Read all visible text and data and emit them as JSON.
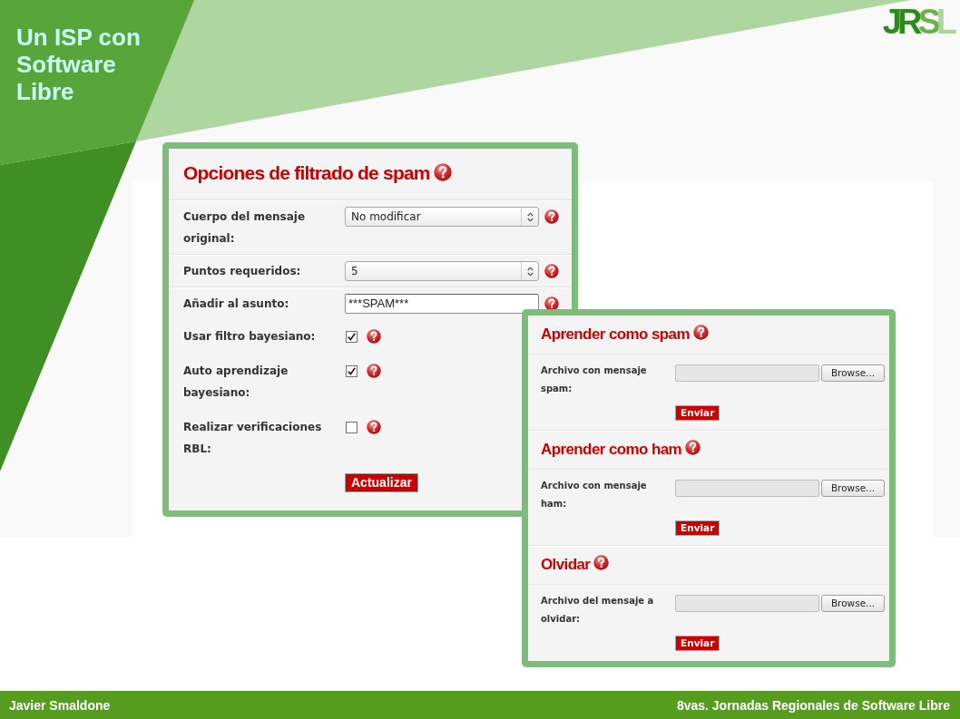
{
  "slide": {
    "title": "Un ISP con Software Libre",
    "logo": "JRSL"
  },
  "spam_options": {
    "title": "Opciones de filtrado de spam",
    "rows": [
      {
        "kind": "select",
        "label": "Cuerpo del mensaje original:",
        "value": "No modificar"
      },
      {
        "kind": "select",
        "label": "Puntos requeridos:",
        "value": "5"
      },
      {
        "kind": "text",
        "label": "Añadir al asunto:",
        "value": "***SPAM***"
      },
      {
        "kind": "checkbox",
        "label": "Usar filtro bayesiano:",
        "checked": true
      },
      {
        "kind": "checkbox",
        "label": "Auto aprendizaje bayesiano:",
        "checked": true
      },
      {
        "kind": "checkbox",
        "label": "Realizar verificaciones RBL:",
        "checked": false
      }
    ],
    "button": "Actualizar"
  },
  "learning": {
    "sections": [
      {
        "title": "Aprender como spam",
        "label": "Archivo con mensaje spam:",
        "browse": "Browse...",
        "button": "Enviar"
      },
      {
        "title": "Aprender como ham",
        "label": "Archivo con mensaje ham:",
        "browse": "Browse...",
        "button": "Enviar"
      },
      {
        "title": "Olvidar",
        "label": "Archivo del mensaje a olvidar:",
        "browse": "Browse...",
        "button": "Enviar"
      }
    ]
  },
  "footer": {
    "author": "Javier Smaldone",
    "event": "8vas. Jornadas Regionales de Software Libre"
  }
}
